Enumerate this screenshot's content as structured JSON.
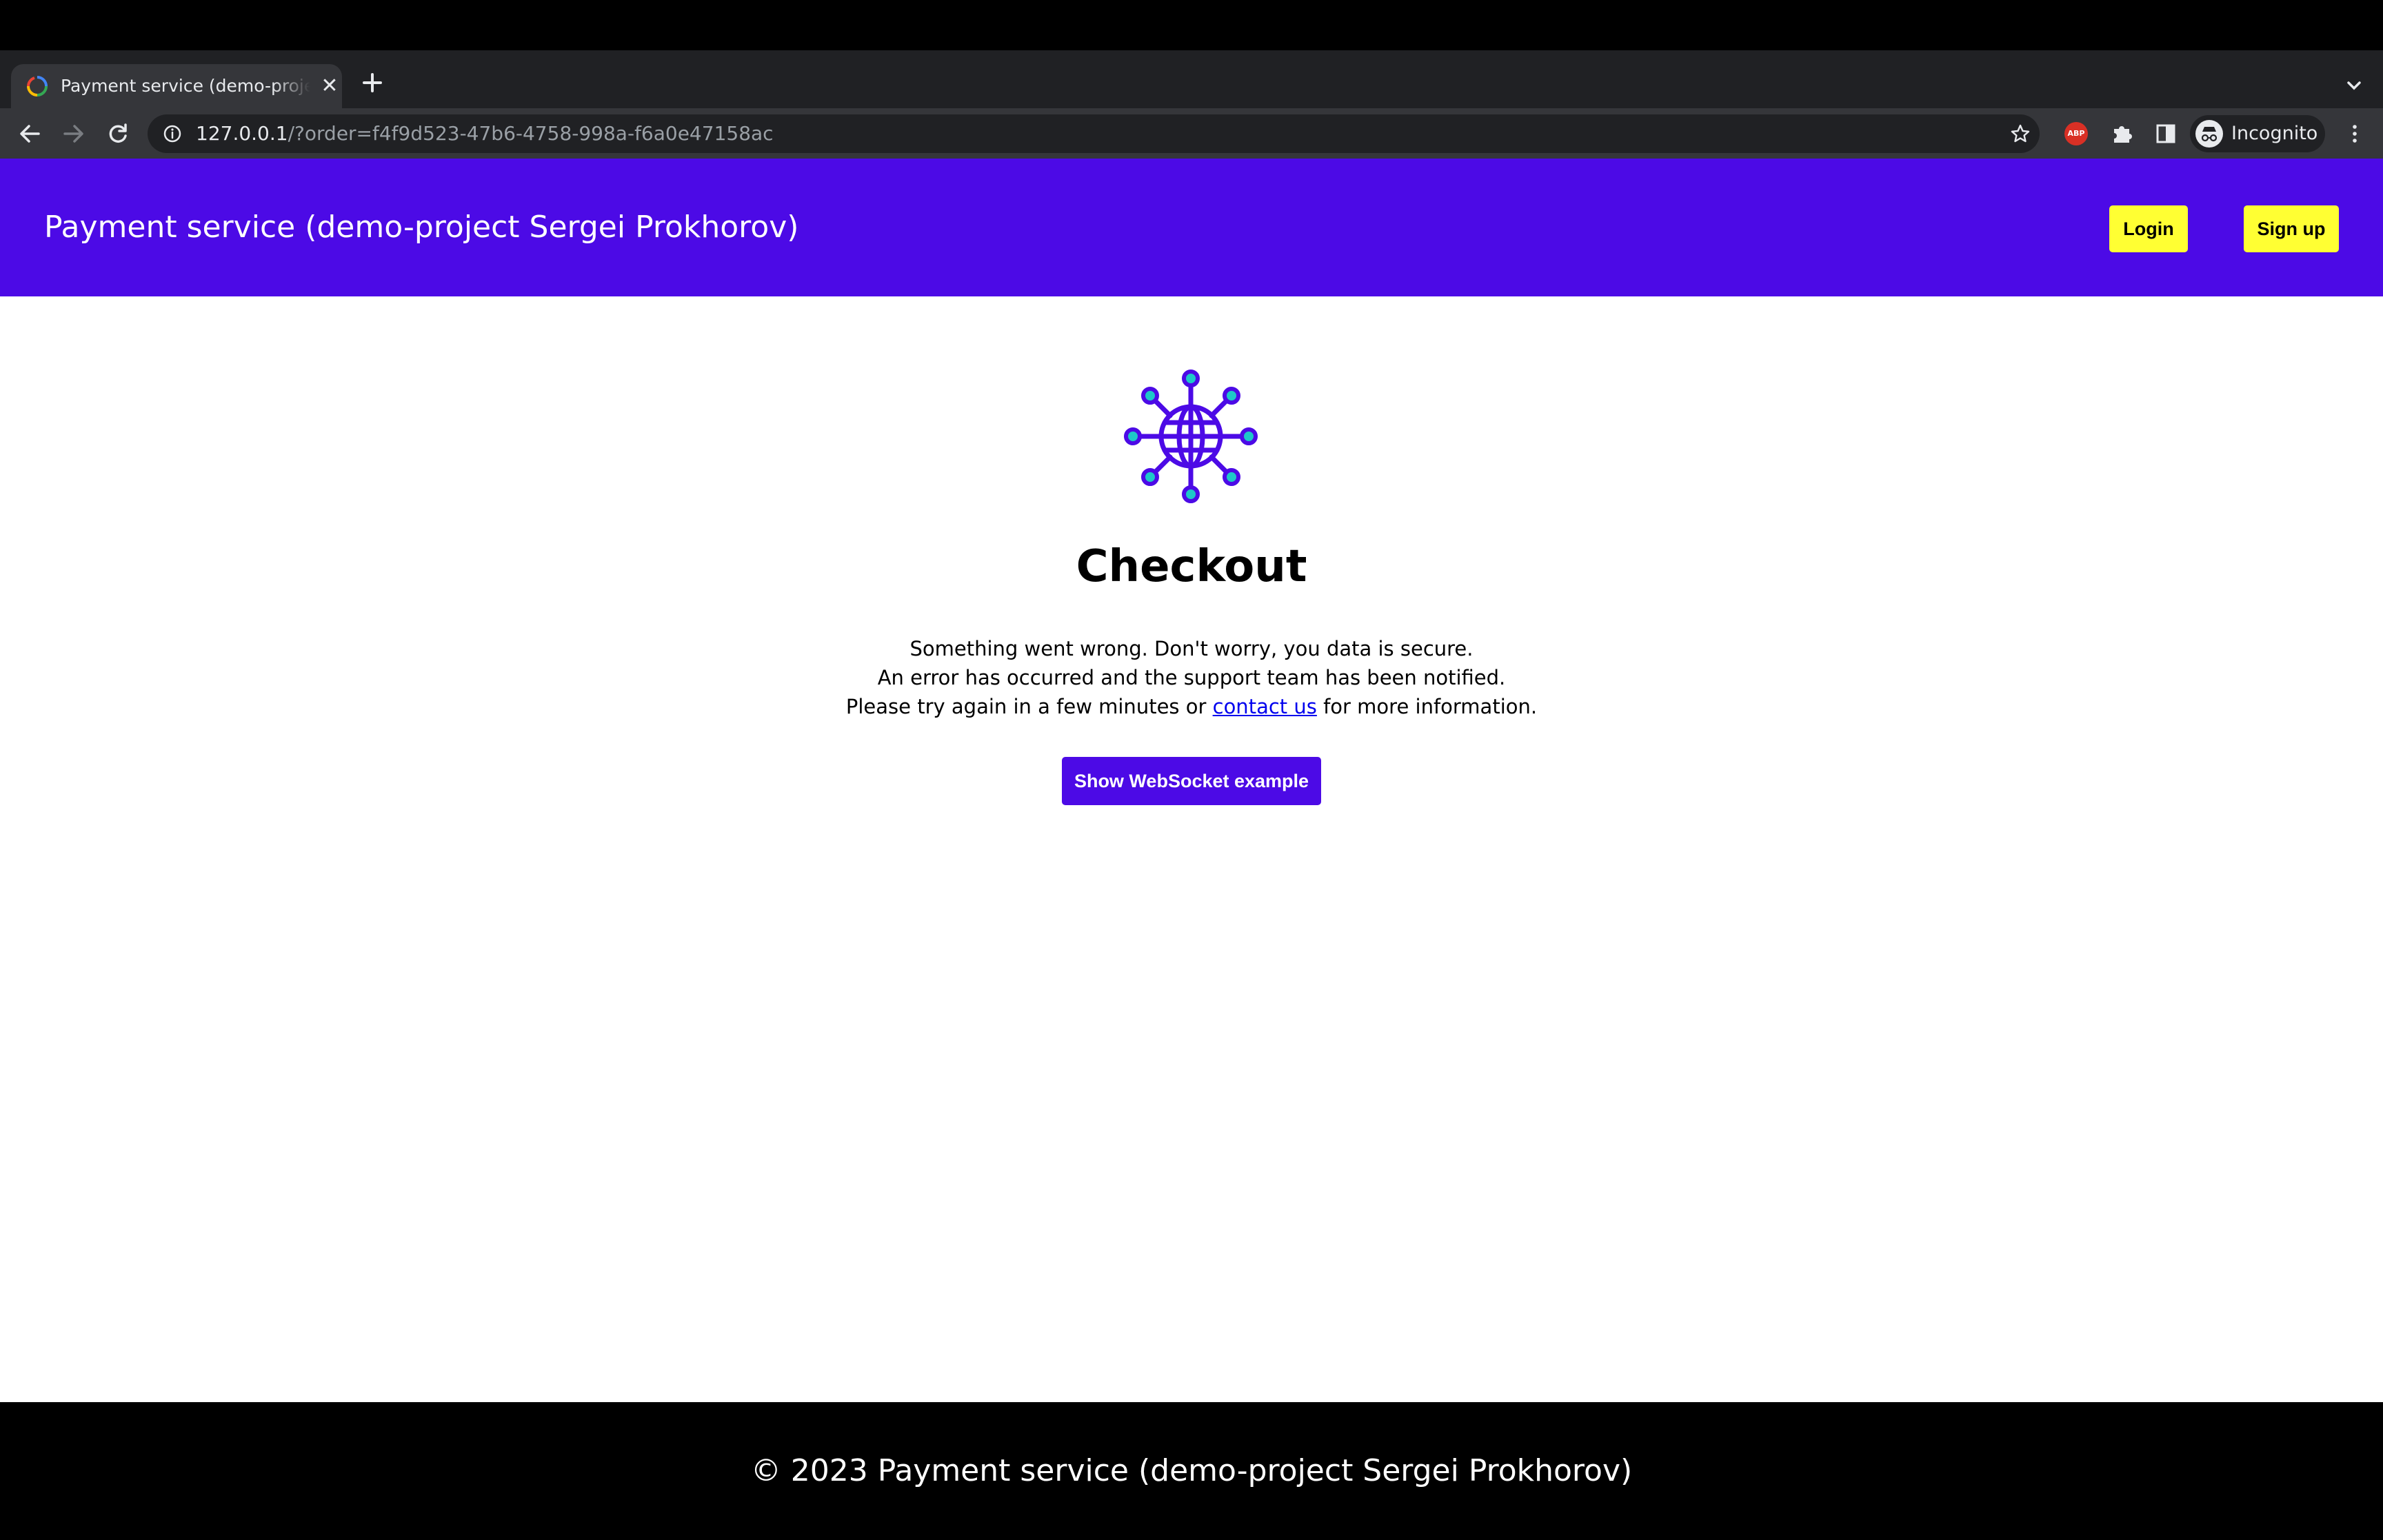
{
  "browser": {
    "tab": {
      "title": "Payment service (demo-project Sergei Prokhorov)"
    },
    "address_bar": {
      "host": "127.0.0.1",
      "path": "/?order=f4f9d523-47b6-4758-998a-f6a0e47158ac"
    },
    "extensions": {
      "abp_label": "ABP"
    },
    "profile": {
      "label": "Incognito"
    }
  },
  "header": {
    "title": "Payment service (demo-project Sergei Prokhorov)",
    "login_label": "Login",
    "signup_label": "Sign up"
  },
  "main": {
    "heading": "Checkout",
    "message": {
      "line1": "Something went wrong. Don't worry, you data is secure.",
      "line2": "An error has occurred and the support team has been notified.",
      "line3_before": "Please try again in a few minutes or ",
      "line3_link": "contact us",
      "line3_after": " for more information."
    },
    "websocket_button_label": "Show WebSocket example"
  },
  "footer": {
    "text": "© 2023 Payment service (demo-project Sergei Prokhorov)"
  },
  "colors": {
    "brand": "#4c0ae6",
    "accent_button": "#ffff33",
    "logo_node_fill": "#1ec8c8"
  },
  "icons": {
    "tab_favicon": "refresh-favicon-icon",
    "logo": "network-globe-icon"
  }
}
